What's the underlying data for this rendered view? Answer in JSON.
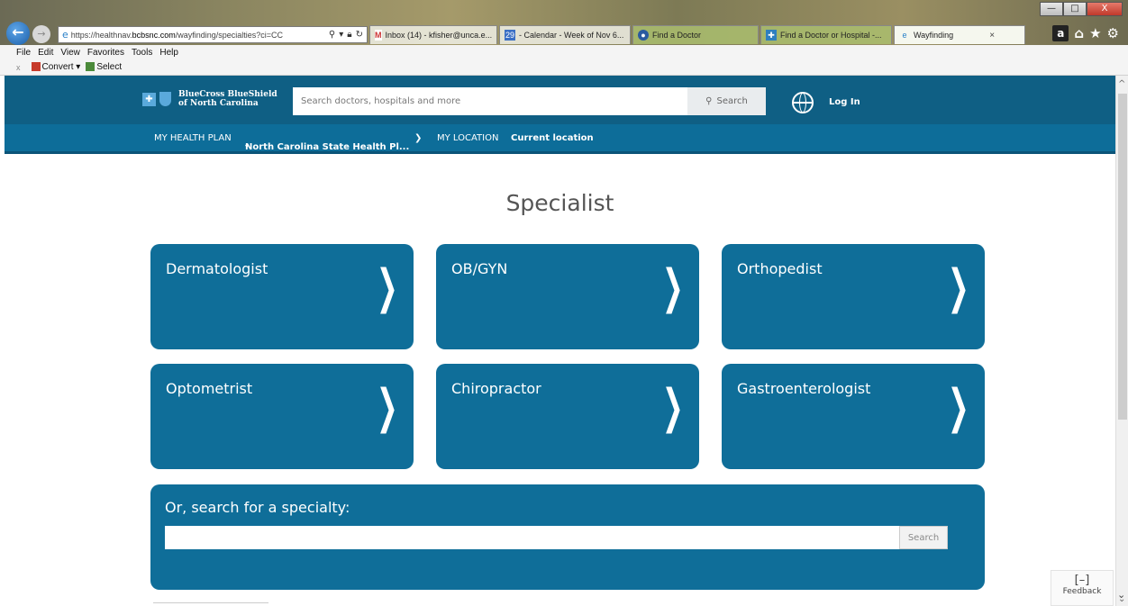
{
  "browser": {
    "address_prefix": "https://healthnav.",
    "address_domain": "bcbsnc.com",
    "address_path": "/wayfinding/specialties?ci=CC",
    "tabs": [
      {
        "label": "Inbox (14) - kfisher@unca.e..."
      },
      {
        "label": "- Calendar - Week of Nov 6...",
        "badge": "29"
      },
      {
        "label": "Find a Doctor"
      },
      {
        "label": "Find a Doctor or Hospital -..."
      },
      {
        "label": "Wayfinding",
        "close": "×"
      }
    ],
    "menu": [
      "File",
      "Edit",
      "View",
      "Favorites",
      "Tools",
      "Help"
    ],
    "commands": {
      "close": "x",
      "convert": "Convert",
      "select": "Select"
    },
    "window_buttons": {
      "min": "—",
      "max": "□",
      "close": "X"
    },
    "amazon": "a"
  },
  "site": {
    "logo_line1": "BlueCross BlueShield",
    "logo_line2": "of North Carolina",
    "search_placeholder": "Search doctors, hospitals and more",
    "search_button": "Search",
    "login": "Log In",
    "subnav": {
      "plan_label": "MY HEALTH PLAN",
      "plan_value": "North Carolina State Health Pl...",
      "location_label": "MY LOCATION",
      "location_value": "Current location"
    }
  },
  "main": {
    "title": "Specialist",
    "cards": [
      {
        "label": "Dermatologist"
      },
      {
        "label": "OB/GYN"
      },
      {
        "label": "Orthopedist"
      },
      {
        "label": "Optometrist"
      },
      {
        "label": "Chiropractor"
      },
      {
        "label": "Gastroenterologist"
      }
    ],
    "chevron": "❯",
    "specialty_search": {
      "label": "Or, search for a specialty:",
      "button": "Search"
    }
  },
  "feedback": {
    "icon": "[–]",
    "label": "Feedback"
  }
}
